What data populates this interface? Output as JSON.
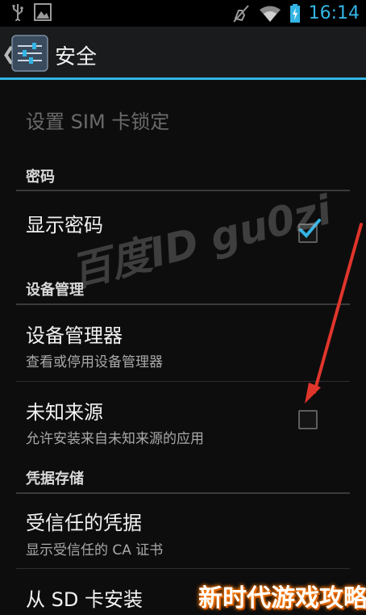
{
  "status_bar": {
    "time": "16:14",
    "left_icons": [
      "usb-icon",
      "screenshot-icon"
    ],
    "right_icons": [
      "vibrate-off-icon",
      "wifi-icon",
      "battery-charging-icon"
    ]
  },
  "action_bar": {
    "title": "安全"
  },
  "list": {
    "sim_lock": "设置 SIM 卡锁定",
    "section_password": "密码",
    "show_password": {
      "title": "显示密码",
      "checked": true
    },
    "section_device_admin": "设备管理",
    "device_admins": {
      "title": "设备管理器",
      "subtitle": "查看或停用设备管理器"
    },
    "unknown_sources": {
      "title": "未知来源",
      "subtitle": "允许安装来自未知来源的应用",
      "checked": false
    },
    "section_credential_storage": "凭据存储",
    "trusted_credentials": {
      "title": "受信任的凭据",
      "subtitle": "显示受信任的 CA 证书"
    },
    "install_from_sd": {
      "title": "从 SD 卡安装"
    }
  },
  "watermark": "百度ID gu0zi",
  "corner_badge": "新时代游戏攻略",
  "colors": {
    "accent": "#33b5e5",
    "arrow": "#e0352b",
    "badge_glow": "#ff7a00"
  }
}
